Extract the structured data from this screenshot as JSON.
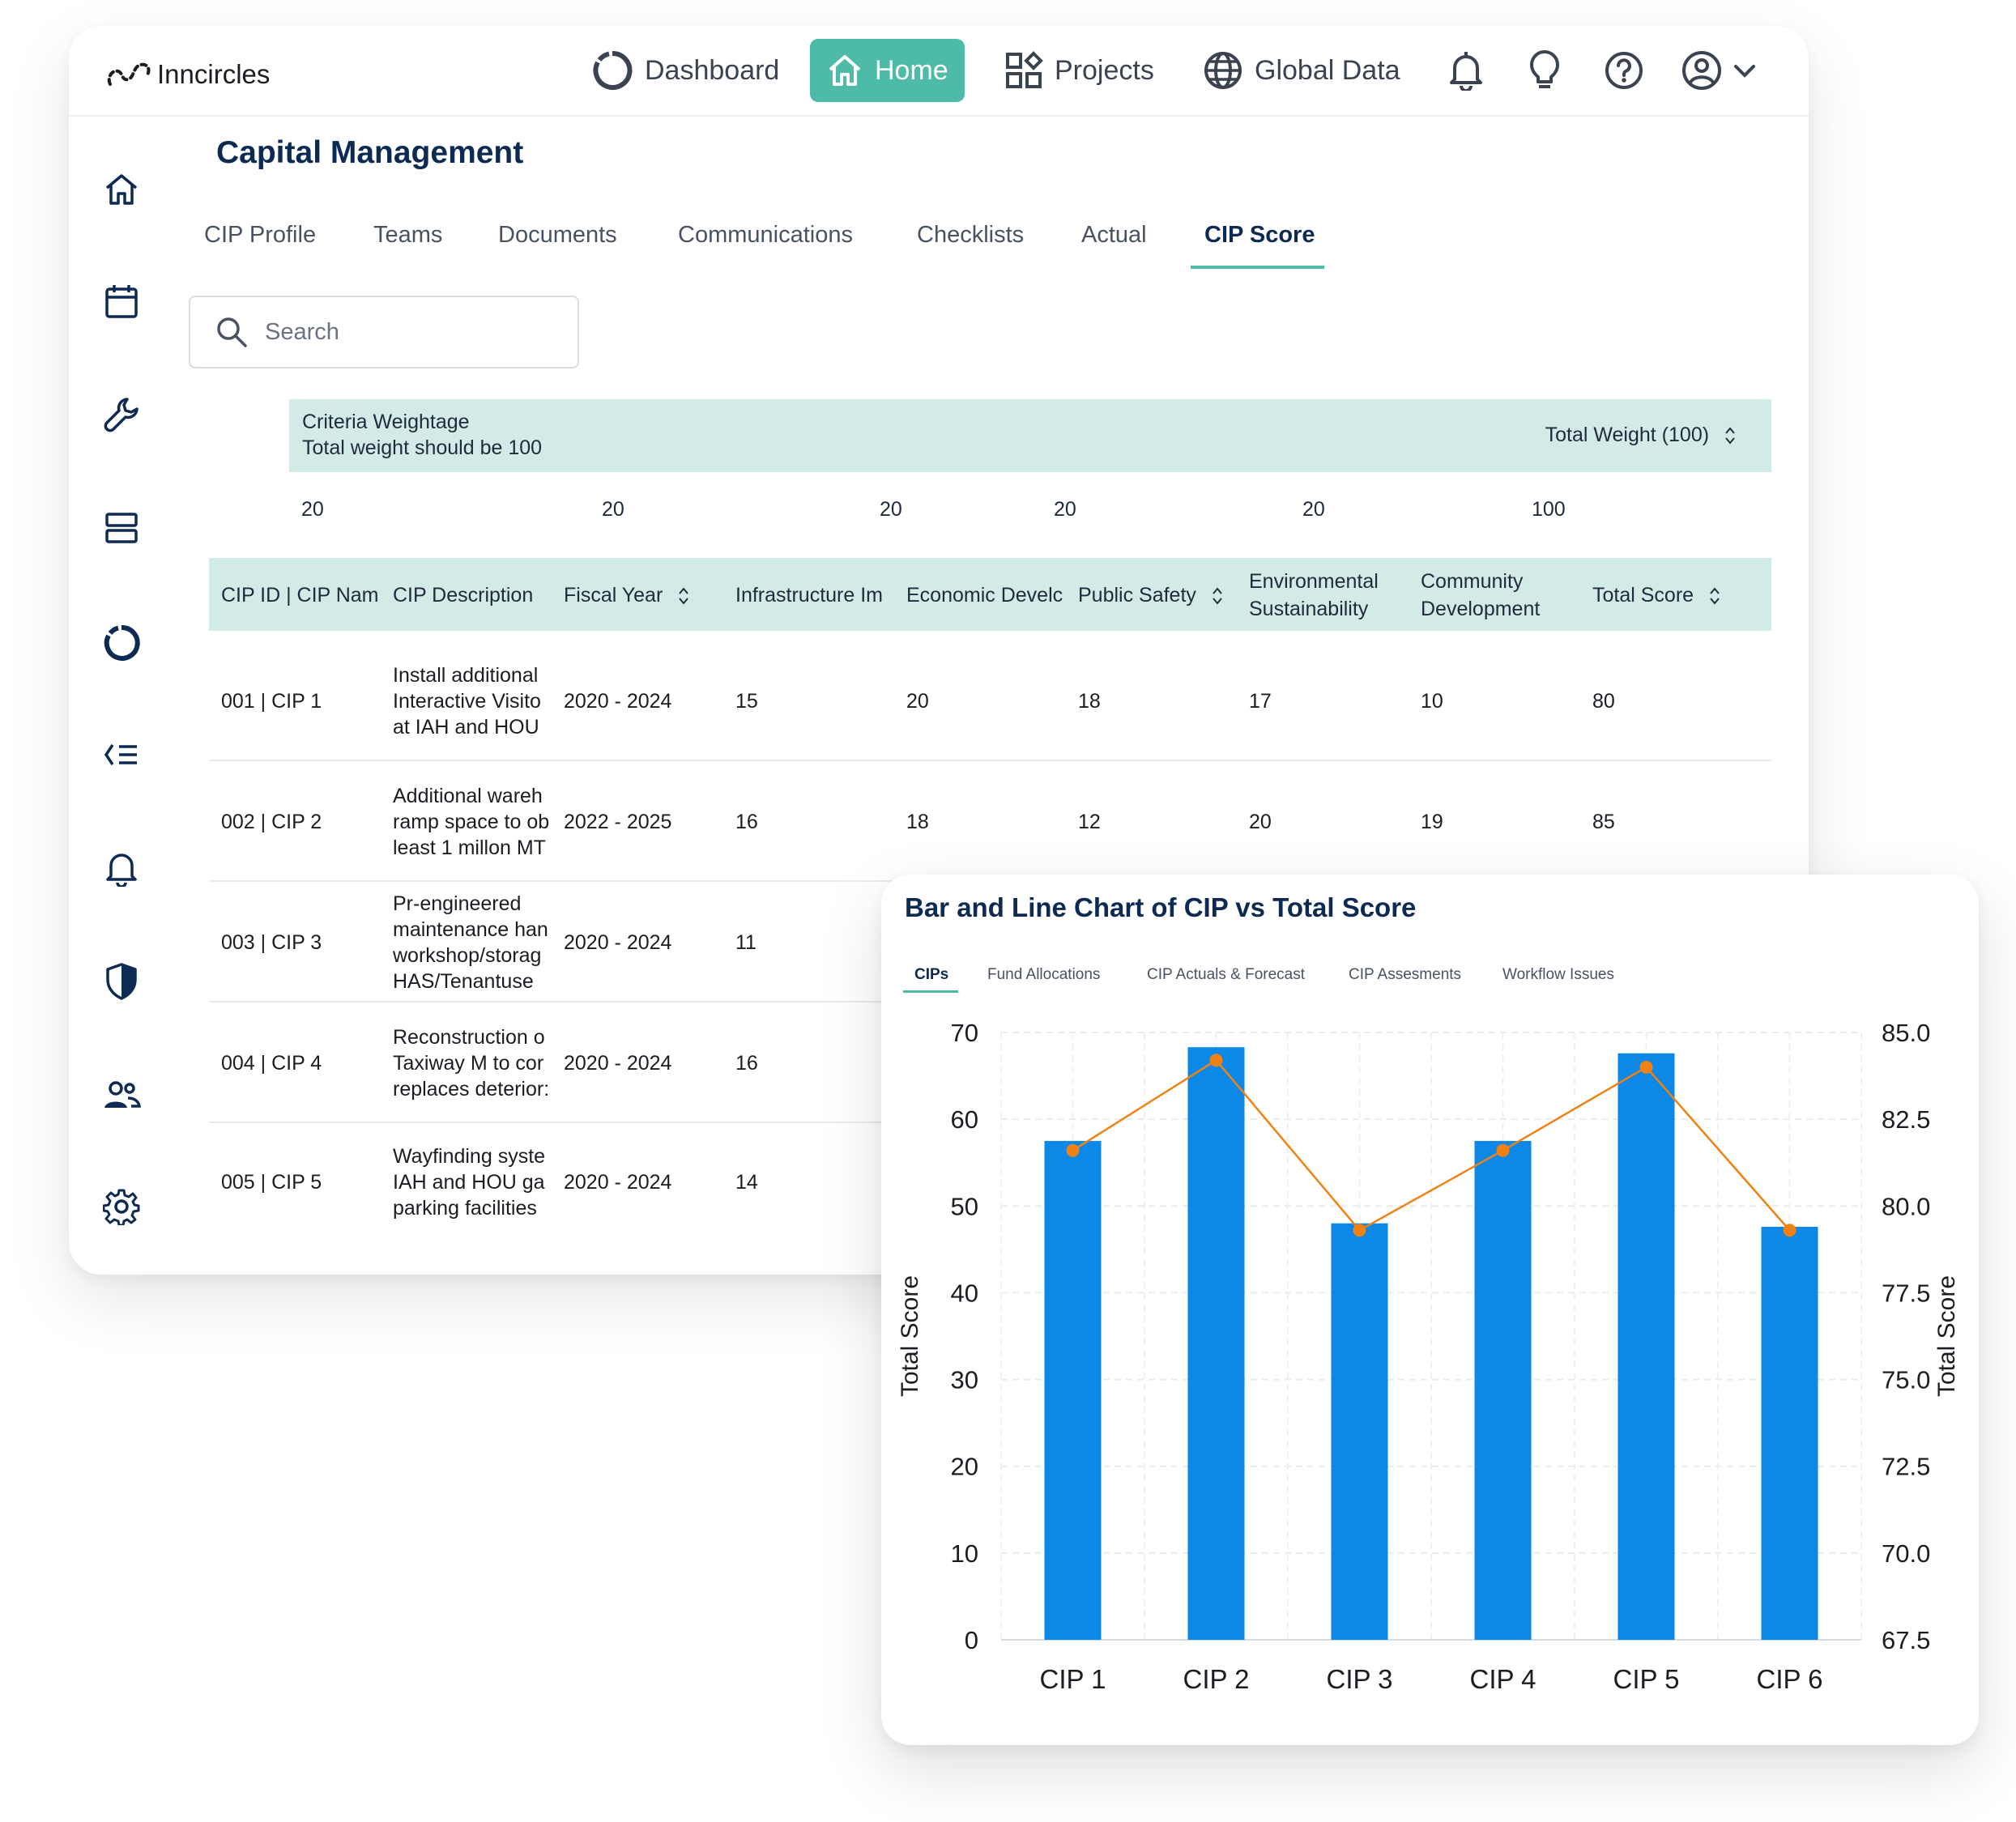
{
  "app": {
    "name": "Inncircles"
  },
  "nav": {
    "dashboard": "Dashboard",
    "home": "Home",
    "projects": "Projects",
    "global_data": "Global Data"
  },
  "sidebar": {
    "icons": [
      "home-icon",
      "calendar-icon",
      "wrench-icon",
      "server-icon",
      "dashboard-icon",
      "list-icon",
      "bell-icon",
      "shield-icon",
      "users-icon",
      "gear-icon"
    ]
  },
  "page": {
    "title": "Capital Management"
  },
  "tabs": [
    "CIP Profile",
    "Teams",
    "Documents",
    "Communications",
    "Checklists",
    "Actual",
    "CIP Score"
  ],
  "active_tab": "CIP Score",
  "search": {
    "placeholder": "Search"
  },
  "weightage": {
    "title": "Criteria Weightage",
    "subtitle": "Total weight should be 100",
    "total_label": "Total Weight (100)",
    "values": [
      "20",
      "20",
      "20",
      "20",
      "20",
      "100"
    ]
  },
  "table": {
    "headers": [
      "CIP ID | CIP Nam",
      "CIP Description",
      "Fiscal Year",
      "Infrastructure Im",
      "Economic Develc",
      "Public Safety",
      "Environmental",
      "Sustainability",
      "Community",
      "Development",
      "Total Score"
    ],
    "rows": [
      {
        "id": "001 | CIP 1",
        "desc": [
          "Install additional",
          "Interactive Visito",
          "at IAH and HOU"
        ],
        "year": "2020 - 2024",
        "infra": "15",
        "econ": "20",
        "safety": "18",
        "env": "17",
        "community": "10",
        "total": "80"
      },
      {
        "id": "002 | CIP 2",
        "desc": [
          "Additional wareh",
          "ramp space to ob",
          "least 1 millon MT"
        ],
        "year": "2022 - 2025",
        "infra": "16",
        "econ": "18",
        "safety": "12",
        "env": "20",
        "community": "19",
        "total": "85"
      },
      {
        "id": "003 | CIP 3",
        "desc": [
          "Pr-engineered",
          "maintenance han",
          "workshop/storag",
          "HAS/Tenantuse"
        ],
        "year": "2020 - 2024",
        "infra": "11"
      },
      {
        "id": "004 | CIP 4",
        "desc": [
          "Reconstruction o",
          "Taxiway M to cor",
          "replaces deterior:"
        ],
        "year": "2020 - 2024",
        "infra": "16"
      },
      {
        "id": "005 | CIP 5",
        "desc": [
          "Wayfinding syste",
          "IAH and HOU ga",
          "parking facilities"
        ],
        "year": "2020 - 2024",
        "infra": "14"
      }
    ]
  },
  "chart_panel": {
    "title": "Bar and Line Chart of CIP vs Total Score",
    "tabs": [
      "CIPs",
      "Fund Allocations",
      "CIP Actuals & Forecast",
      "CIP Assesments",
      "Workflow Issues"
    ],
    "active_tab": "CIPs"
  },
  "chart_data": {
    "type": "bar+line",
    "title": "Bar and Line Chart of CIP vs Total Score",
    "categories": [
      "CIP 1",
      "CIP 2",
      "CIP 3",
      "CIP 4",
      "CIP 5",
      "CIP 6"
    ],
    "y_left": {
      "label": "Total Score",
      "min": 0,
      "max": 70,
      "ticks": [
        0,
        10,
        20,
        30,
        40,
        50,
        60,
        70
      ]
    },
    "y_right": {
      "label": "Total Score",
      "min": 67.5,
      "max": 85.0,
      "ticks": [
        "67.5",
        "70.0",
        "72.5",
        "75.0",
        "77.5",
        "80.0",
        "82.5",
        "85.0"
      ]
    },
    "bar_series": {
      "values": [
        57.5,
        68.3,
        48.0,
        57.5,
        67.6,
        47.6
      ],
      "color": "#0d88e6"
    },
    "line_series": {
      "values": [
        81.6,
        84.2,
        79.3,
        81.6,
        84.0,
        79.3
      ],
      "color": "#f08214"
    },
    "grid": true,
    "legend": "none"
  }
}
